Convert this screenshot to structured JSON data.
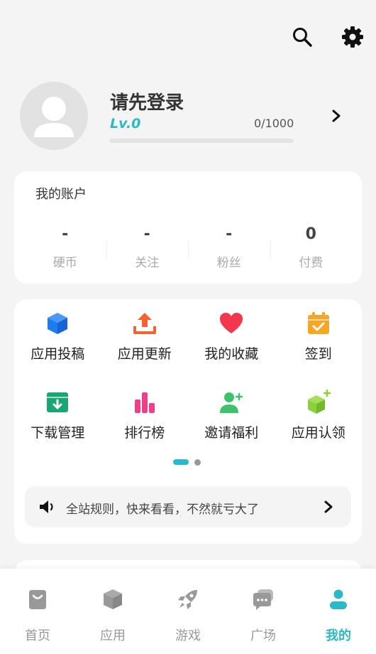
{
  "colors": {
    "accent": "#29b9c9",
    "background": "#f4f4f4",
    "card": "#ffffff",
    "icon_blue": "#1e7cf2",
    "icon_orange": "#f5612f",
    "icon_red": "#f2374e",
    "icon_yellow": "#f5a623",
    "icon_green": "#1aa672",
    "icon_pink": "#ee3f8a",
    "icon_lightgreen": "#3cc26a",
    "icon_lime": "#8bd13a"
  },
  "top_bar": {
    "icons": [
      "search-icon",
      "gear-icon"
    ]
  },
  "profile": {
    "title": "请先登录",
    "level": "Lv.0",
    "exp_text": "0/1000",
    "exp_progress": 0
  },
  "account": {
    "title": "我的账户",
    "stats": [
      {
        "value": "-",
        "label": "硬币"
      },
      {
        "value": "-",
        "label": "关注"
      },
      {
        "value": "-",
        "label": "粉丝"
      },
      {
        "value": "0",
        "label": "付费"
      }
    ]
  },
  "features": {
    "items": [
      {
        "label": "应用投稿",
        "icon": "cube-icon"
      },
      {
        "label": "应用更新",
        "icon": "upload-icon"
      },
      {
        "label": "我的收藏",
        "icon": "heart-icon"
      },
      {
        "label": "签到",
        "icon": "calendar-check-icon"
      },
      {
        "label": "下载管理",
        "icon": "download-box-icon"
      },
      {
        "label": "排行榜",
        "icon": "bar-chart-icon"
      },
      {
        "label": "邀请福利",
        "icon": "add-user-icon"
      },
      {
        "label": "应用认领",
        "icon": "cube-plus-icon"
      }
    ],
    "page_count": 2,
    "current_page": 1
  },
  "notice": {
    "text": "全站规则，快来看看，不然就亏大了",
    "icon": "speaker-icon"
  },
  "bottom_nav": {
    "items": [
      {
        "label": "首页",
        "icon": "bag-icon"
      },
      {
        "label": "应用",
        "icon": "box-icon"
      },
      {
        "label": "游戏",
        "icon": "rocket-icon"
      },
      {
        "label": "广场",
        "icon": "chat-icon"
      },
      {
        "label": "我的",
        "icon": "person-icon",
        "active": true
      }
    ]
  }
}
